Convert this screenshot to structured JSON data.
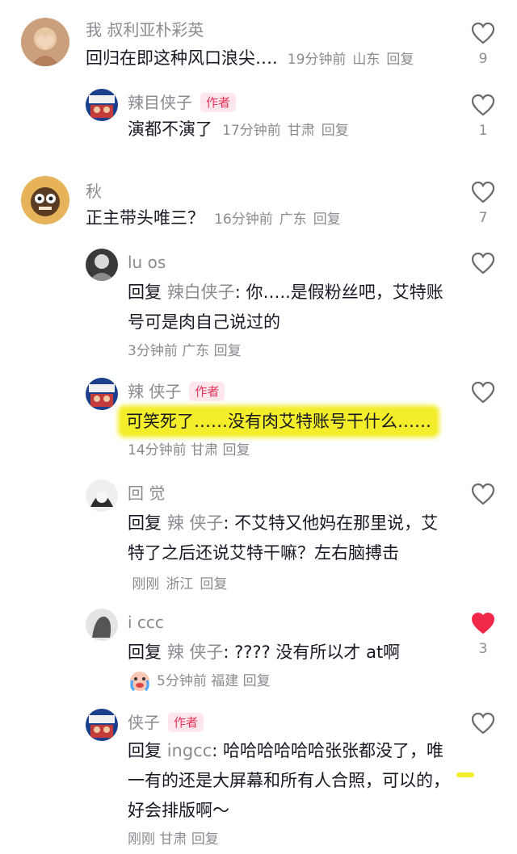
{
  "comments": [
    {
      "username": "我 叔利亚朴彩英",
      "text": "回归在即这种风口浪尖….",
      "time": "19分钟前",
      "location": "山东",
      "reply_label": "回复",
      "likes": "9"
    },
    {
      "username": "辣目侠子",
      "author_tag": "作者",
      "text": "演都不演了",
      "time": "17分钟前",
      "location": "甘肃",
      "reply_label": "回复",
      "likes": "1"
    },
    {
      "username": "秋",
      "text": "正主带头唯三？",
      "time": "16分钟前",
      "location": "广东",
      "reply_label": "回复",
      "likes": "7"
    },
    {
      "username": "lu os",
      "reply_prefix": "回复",
      "reply_to": "辣白侠子",
      "text": "你…..是假粉丝吧，艾特账号可是肉自己说过的",
      "time": "3分钟前",
      "location": "广东",
      "reply_label": "回复"
    },
    {
      "username": "辣 侠子",
      "author_tag": "作者",
      "text": "可笑死了……没有肉艾特账号干什么……",
      "time": "14分钟前",
      "location": "甘肃",
      "reply_label": "回复"
    },
    {
      "username": "回 觉",
      "reply_prefix": "回复",
      "reply_to": "辣 侠子",
      "text": "不艾特又他妈在那里说，艾特了之后还说艾特干嘛？左右脑搏击",
      "time": "刚刚",
      "location": "浙江",
      "reply_label": "回复"
    },
    {
      "username": "i ccc",
      "reply_prefix": "回复",
      "reply_to": "辣 侠子",
      "text": "???? 没有所以才 at啊",
      "time": "5分钟前",
      "location": "福建",
      "reply_label": "回复",
      "likes": "3"
    },
    {
      "username": "侠子",
      "author_tag": "作者",
      "reply_prefix": "回复",
      "reply_to": "ingcc",
      "text": "哈哈哈哈哈哈张张都没了，唯一有的还是大屏幕和所有人合照，可以的，好会排版啊～",
      "time": "刚刚",
      "location": "甘肃",
      "reply_label": "回复"
    }
  ],
  "colors": {
    "highlight": "#f4ee2a",
    "author_tag_text": "#e8335b",
    "liked_heart": "#f0294a",
    "meta_gray": "#8a8b91"
  }
}
